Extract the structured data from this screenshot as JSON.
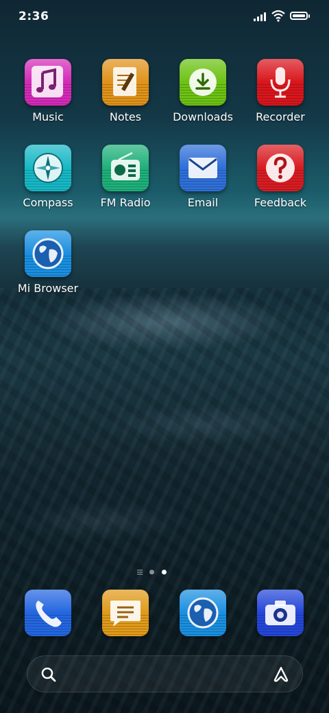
{
  "status_bar": {
    "time": "2:36"
  },
  "apps": [
    {
      "label": "Music",
      "icon": "music-note-icon",
      "color": "#d42ab8"
    },
    {
      "label": "Notes",
      "icon": "notepad-pencil-icon",
      "color": "#e0921a"
    },
    {
      "label": "Downloads",
      "icon": "download-arrow-icon",
      "color": "#6cc214"
    },
    {
      "label": "Recorder",
      "icon": "microphone-icon",
      "color": "#d8161c"
    },
    {
      "label": "Compass",
      "icon": "compass-icon",
      "color": "#17b8c6"
    },
    {
      "label": "FM Radio",
      "icon": "radio-icon",
      "color": "#1fb07a"
    },
    {
      "label": "Email",
      "icon": "envelope-icon",
      "color": "#2f6fd8"
    },
    {
      "label": "Feedback",
      "icon": "question-mark-icon",
      "color": "#d81c22"
    },
    {
      "label": "Mi Browser",
      "icon": "globe-icon",
      "color": "#1a8fe0"
    }
  ],
  "dock": [
    {
      "icon": "phone-icon",
      "color": "#2466e0"
    },
    {
      "icon": "message-bubble-icon",
      "color": "#e09a1a"
    },
    {
      "icon": "globe-icon",
      "color": "#1a8fe0"
    },
    {
      "icon": "camera-icon",
      "color": "#2446d8"
    }
  ],
  "page_indicator": {
    "pages": 2,
    "current": 2
  },
  "search_bar": {
    "left_icon": "search-icon",
    "right_icon": "assistant-a-icon"
  }
}
